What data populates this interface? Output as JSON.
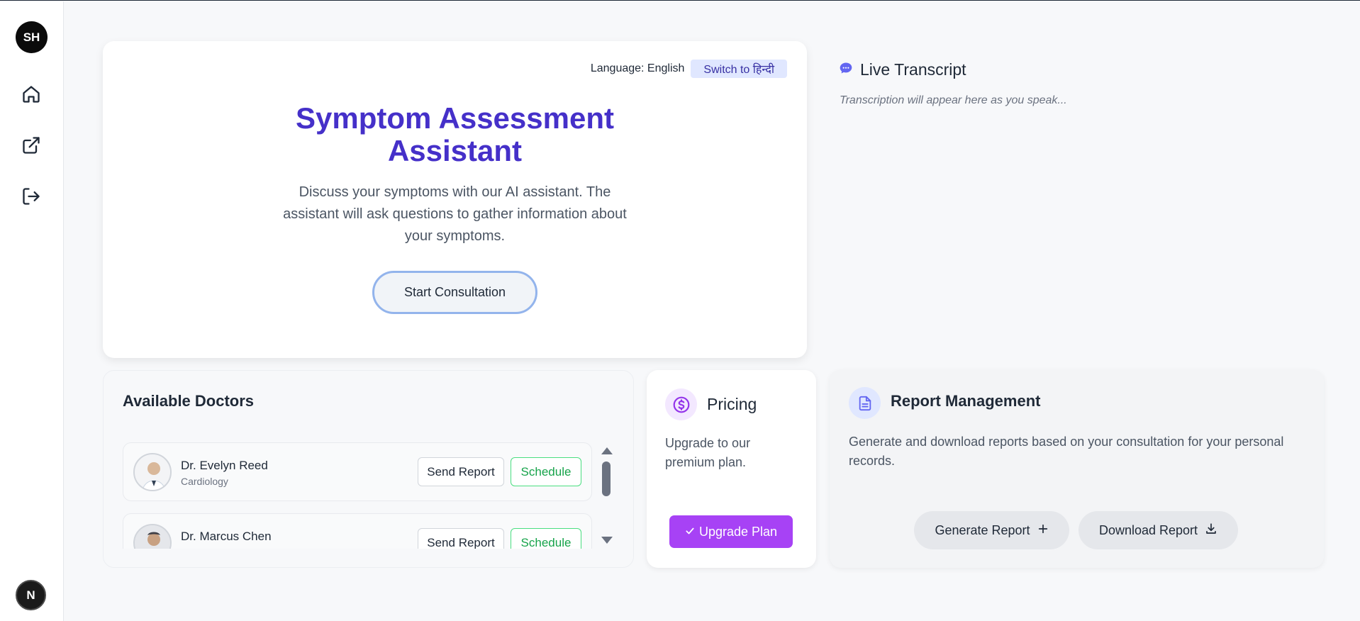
{
  "sidebar": {
    "avatar_initials": "SH",
    "items": [
      {
        "name": "home",
        "icon": "home-icon"
      },
      {
        "name": "external",
        "icon": "external-link-icon"
      },
      {
        "name": "logout",
        "icon": "logout-icon"
      }
    ],
    "bottom_badge": "N"
  },
  "assessment": {
    "language_label": "Language: English",
    "switch_label": "Switch to हिन्दी",
    "title": "Symptom Assessment Assistant",
    "description": "Discuss your symptoms with our AI assistant. The assistant will ask questions to gather information about your symptoms.",
    "start_button": "Start Consultation"
  },
  "transcript": {
    "title": "Live Transcript",
    "placeholder": "Transcription will appear here as you speak...",
    "icon": "chat-bubble-icon",
    "icon_color": "#6366f1"
  },
  "doctors": {
    "title": "Available Doctors",
    "list": [
      {
        "name": "Dr. Evelyn Reed",
        "specialty": "Cardiology",
        "send_label": "Send Report",
        "schedule_label": "Schedule"
      },
      {
        "name": "Dr. Marcus Chen",
        "specialty": "",
        "send_label": "Send Report",
        "schedule_label": "Schedule"
      }
    ]
  },
  "pricing": {
    "title": "Pricing",
    "description": "Upgrade to our premium plan.",
    "button": "Upgrade Plan",
    "icon": "dollar-icon",
    "accent": "#a742f5"
  },
  "report": {
    "title": "Report Management",
    "description": "Generate and download reports based on your consultation for your personal records.",
    "generate_button": "Generate Report",
    "download_button": "Download Report",
    "icon": "document-icon"
  },
  "colors": {
    "brand_primary": "#4530c9",
    "schedule_green": "#16a34a",
    "upgrade_purple": "#a742f5"
  }
}
